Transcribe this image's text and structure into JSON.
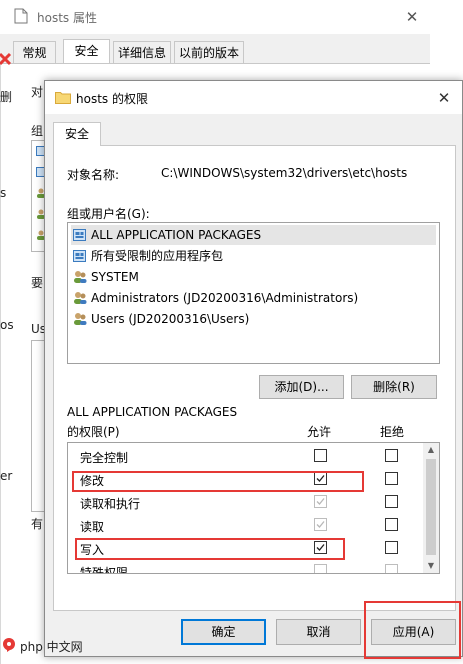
{
  "background_window": {
    "title": "hosts 属性",
    "close_glyph": "✕",
    "tabs": [
      "常规",
      "安全",
      "详细信息",
      "以前的版本"
    ],
    "active_tab": "安全",
    "fragments": [
      "对",
      "组",
      "要",
      "Us",
      "有",
      "删",
      "s",
      "os",
      "er"
    ]
  },
  "dialog": {
    "title": "hosts 的权限",
    "close_glyph": "✕",
    "tab": "安全",
    "object_name_label": "对象名称:",
    "object_name_value": "C:\\WINDOWS\\system32\\drivers\\etc\\hosts",
    "groups_label": "组或用户名(G):",
    "users": [
      {
        "label": "ALL APPLICATION PACKAGES",
        "icon": "group-package-icon",
        "selected": true
      },
      {
        "label": "所有受限制的应用程序包",
        "icon": "group-package-icon",
        "selected": false
      },
      {
        "label": "SYSTEM",
        "icon": "users-icon",
        "selected": false
      },
      {
        "label": "Administrators (JD20200316\\Administrators)",
        "icon": "users-icon",
        "selected": false
      },
      {
        "label": "Users (JD20200316\\Users)",
        "icon": "users-icon",
        "selected": false
      }
    ],
    "add_button": "添加(D)...",
    "remove_button": "删除(R)",
    "permissions_for_line1": "ALL APPLICATION PACKAGES",
    "permissions_for_line2": "的权限(P)",
    "allow_header": "允许",
    "deny_header": "拒绝",
    "permissions": [
      {
        "label": "完全控制",
        "allow": false,
        "allow_disabled": false,
        "deny": false,
        "highlighted": false
      },
      {
        "label": "修改",
        "allow": true,
        "allow_disabled": false,
        "deny": false,
        "highlighted": true
      },
      {
        "label": "读取和执行",
        "allow": true,
        "allow_disabled": true,
        "deny": false,
        "highlighted": false
      },
      {
        "label": "读取",
        "allow": true,
        "allow_disabled": true,
        "deny": false,
        "highlighted": false
      },
      {
        "label": "写入",
        "allow": true,
        "allow_disabled": false,
        "deny": false,
        "highlighted": true
      },
      {
        "label": "特殊权限",
        "allow": false,
        "allow_disabled": true,
        "deny": false,
        "highlighted": false
      }
    ],
    "ok_button": "确定",
    "cancel_button": "取消",
    "apply_button": "应用(A)",
    "colors": {
      "highlight": "#e53935",
      "focus": "#0078d7",
      "selection": "#e5e5e5"
    }
  },
  "watermark": {
    "text": "php 中文网",
    "icon": "php-logo-icon"
  }
}
